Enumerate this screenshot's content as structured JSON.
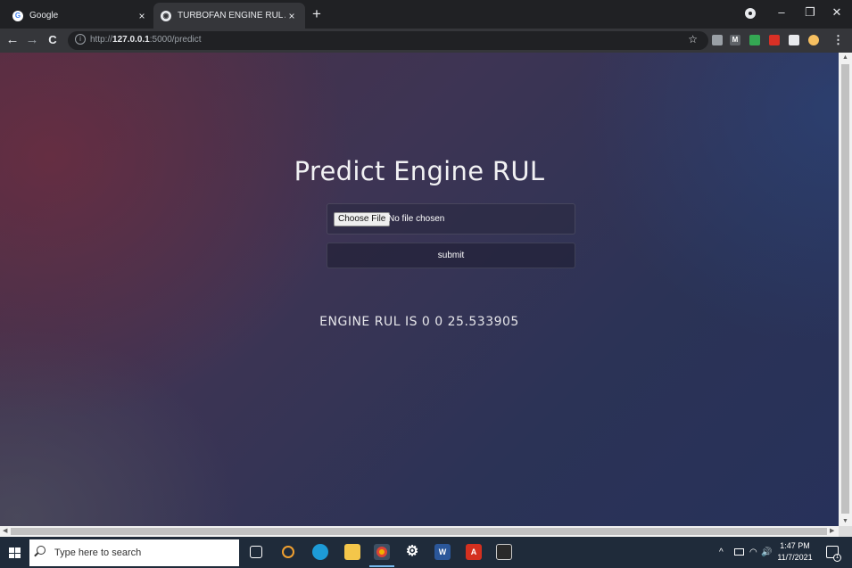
{
  "browser": {
    "tabs": [
      {
        "title": "Google",
        "favicon": "google-icon",
        "active": false
      },
      {
        "title": "TURBOFAN ENGINE RUL API",
        "favicon": "globe-icon",
        "active": true
      }
    ],
    "tab_close": "×",
    "new_tab": "+",
    "window_controls": {
      "minimize": "–",
      "restore": "❐",
      "close": "✕"
    },
    "nav": {
      "back": "←",
      "forward": "→",
      "reload": "C"
    },
    "address": {
      "prefix": "http://",
      "host": "127.0.0.1",
      "rest": ":5000/predict"
    },
    "star": "☆",
    "menu": "⋮",
    "extension_colors": [
      "#9aa0a6",
      "#5f6368",
      "#34a853",
      "#d93025",
      "#e8eaed",
      "#f6bf60"
    ]
  },
  "page": {
    "heading": "Predict Engine RUL",
    "file_button": "Choose File",
    "file_status": "No file chosen",
    "submit_label": "submit",
    "result": "ENGINE RUL IS 0 0 25.533905"
  },
  "taskbar": {
    "search_placeholder": "Type here to search",
    "apps": [
      "task-view",
      "cortana",
      "edge",
      "file-explorer",
      "chrome",
      "settings",
      "word",
      "acrobat",
      "terminal"
    ],
    "tray": {
      "chevron": "^",
      "volume": "🔊"
    },
    "time": "1:47 PM",
    "date": "11/7/2021",
    "notification_count": "1"
  },
  "colors": {
    "tabstrip": "#202124",
    "toolbar": "#35363a",
    "taskbar": "#1f2b3a",
    "page_gradient_start": "#4a3046",
    "page_gradient_end": "#27315a"
  }
}
